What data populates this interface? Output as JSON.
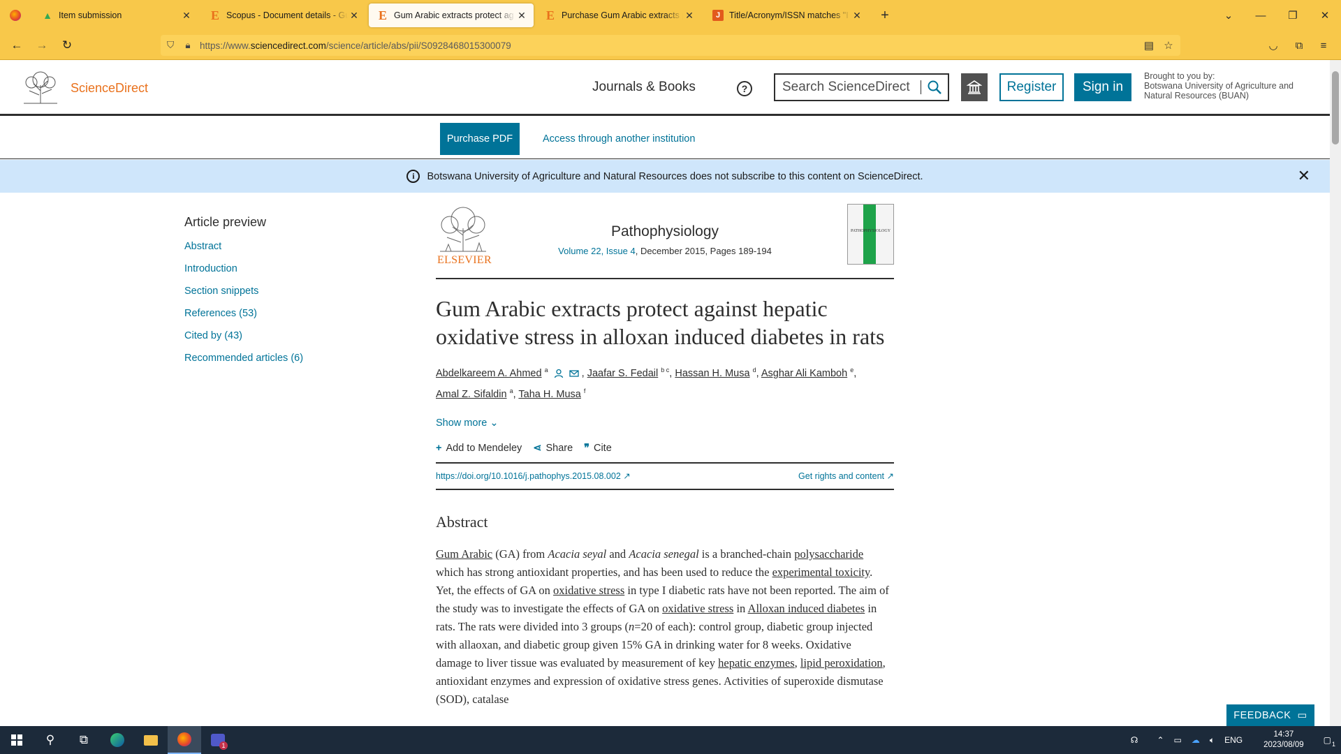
{
  "browser": {
    "tabs": [
      {
        "title": "Item submission",
        "favicon": "google-drive-icon",
        "active": false
      },
      {
        "title": "Scopus - Document details - Gu",
        "favicon": "elsevier-e-icon",
        "active": false
      },
      {
        "title": "Gum Arabic extracts protect ag",
        "favicon": "elsevier-e-icon",
        "active": true
      },
      {
        "title": "Purchase Gum Arabic extracts p",
        "favicon": "elsevier-e-icon",
        "active": false
      },
      {
        "title": "Title/Acronym/ISSN matches \"I",
        "favicon": "j-icon",
        "active": false
      }
    ],
    "url_prefix": "https://www.",
    "url_domain": "sciencedirect.com",
    "url_path": "/science/article/abs/pii/S0928468015300079",
    "accent_color": "#f8c84a"
  },
  "header": {
    "brand": "ScienceDirect",
    "journals_books": "Journals & Books",
    "search_placeholder": "Search ScienceDirect",
    "register": "Register",
    "sign_in": "Sign in",
    "brought_to_you": "Brought to you by:",
    "institution": "Botswana University of Agriculture and Natural Resources (BUAN)"
  },
  "subbar": {
    "purchase_pdf": "Purchase PDF",
    "access": "Access through another institution"
  },
  "notice": {
    "text": "Botswana University of Agriculture and Natural Resources does not subscribe to this content on ScienceDirect."
  },
  "sidebar": {
    "heading": "Article preview",
    "items": [
      "Abstract",
      "Introduction",
      "Section snippets",
      "References (53)",
      "Cited by (43)",
      "Recommended articles (6)"
    ]
  },
  "article": {
    "publisher": "ELSEVIER",
    "journal": "Pathophysiology",
    "volume_link": "Volume 22, Issue 4",
    "volume_rest": ", December 2015, Pages 189-194",
    "cover_text": "PATHOPHYSIOLOGY",
    "title": "Gum Arabic extracts protect against hepatic oxidative stress in alloxan induced diabetes in rats",
    "authors": [
      {
        "name": "Abdelkareem A. Ahmed",
        "sup": "a"
      },
      {
        "name": "Jaafar S. Fedail",
        "sup": "b c"
      },
      {
        "name": "Hassan H. Musa",
        "sup": "d"
      },
      {
        "name": "Asghar Ali Kamboh",
        "sup": "e"
      },
      {
        "name": "Amal Z. Sifaldin",
        "sup": "a"
      },
      {
        "name": "Taha H. Musa",
        "sup": "f"
      }
    ],
    "show_more": "Show more",
    "add_mendeley": "Add to Mendeley",
    "share": "Share",
    "cite": "Cite",
    "doi": "https://doi.org/10.1016/j.pathophys.2015.08.002",
    "rights": "Get rights and content",
    "abstract_heading": "Abstract",
    "abstract": {
      "s1": "Gum Arabic",
      "s2": " (GA) from ",
      "s3": "Acacia seyal",
      "s4": " and ",
      "s5": "Acacia senegal",
      "s6": " is a branched-chain ",
      "s7": "polysaccharide",
      "s8": " which has strong antioxidant properties, and has been used to reduce the ",
      "s9": "experimental toxicity",
      "s10": ". Yet, the effects of GA on ",
      "s11": "oxidative stress",
      "s12": " in type I diabetic rats have not been reported. The aim of the study was to investigate the effects of GA on ",
      "s13": "oxidative stress",
      "s14": " in ",
      "s15": "Alloxan induced diabetes",
      "s16": " in rats. The rats were divided into 3 groups (",
      "s17": "n",
      "s18": "=20 of each): control group, diabetic group injected with allaoxan, and diabetic group given 15% GA in drinking water for 8 weeks. Oxidative damage to liver tissue was evaluated by measurement of key ",
      "s19": "hepatic enzymes",
      "s20": ", ",
      "s21": "lipid peroxidation",
      "s22": ", antioxidant enzymes and expression of oxidative stress genes. Activities of superoxide dismutase (SOD), catalase"
    }
  },
  "feedback": "FEEDBACK",
  "taskbar": {
    "language": "ENG",
    "time": "14:37",
    "date": "2023/08/09",
    "teams_badge": "1",
    "notif_badge": "1"
  }
}
